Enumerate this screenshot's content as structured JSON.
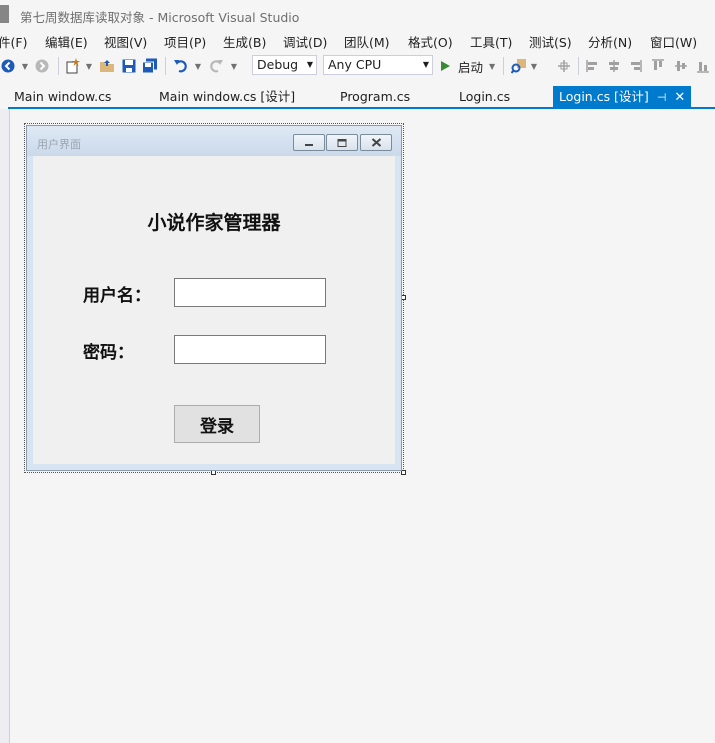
{
  "window": {
    "title": "第七周数据库读取对象 - Microsoft Visual Studio"
  },
  "menu": {
    "items": [
      {
        "label": "件(F)"
      },
      {
        "label": "编辑(E)"
      },
      {
        "label": "视图(V)"
      },
      {
        "label": "项目(P)"
      },
      {
        "label": "生成(B)"
      },
      {
        "label": "调试(D)"
      },
      {
        "label": "团队(M)"
      },
      {
        "label": "格式(O)"
      },
      {
        "label": "工具(T)"
      },
      {
        "label": "测试(S)"
      },
      {
        "label": "分析(N)"
      },
      {
        "label": "窗口(W)"
      }
    ]
  },
  "toolbar": {
    "configuration": "Debug",
    "platform": "Any CPU",
    "start_label": "启动",
    "colors": {
      "back": "#1e5ab8",
      "start": "#388a34",
      "save": "#1e5ab8",
      "folder": "#dcb67a"
    }
  },
  "tabs": [
    {
      "label": "Main window.cs"
    },
    {
      "label": "Main window.cs [设计]"
    },
    {
      "label": "Program.cs"
    },
    {
      "label": "Login.cs"
    },
    {
      "label": "Login.cs [设计]",
      "active": true
    }
  ],
  "theme": {
    "accent": "#007acc"
  },
  "form": {
    "title": "用户界面",
    "heading": "小说作家管理器",
    "username_label": "用户名：",
    "username_value": "",
    "password_label": "密码：",
    "password_value": "",
    "login_label": "登录"
  }
}
